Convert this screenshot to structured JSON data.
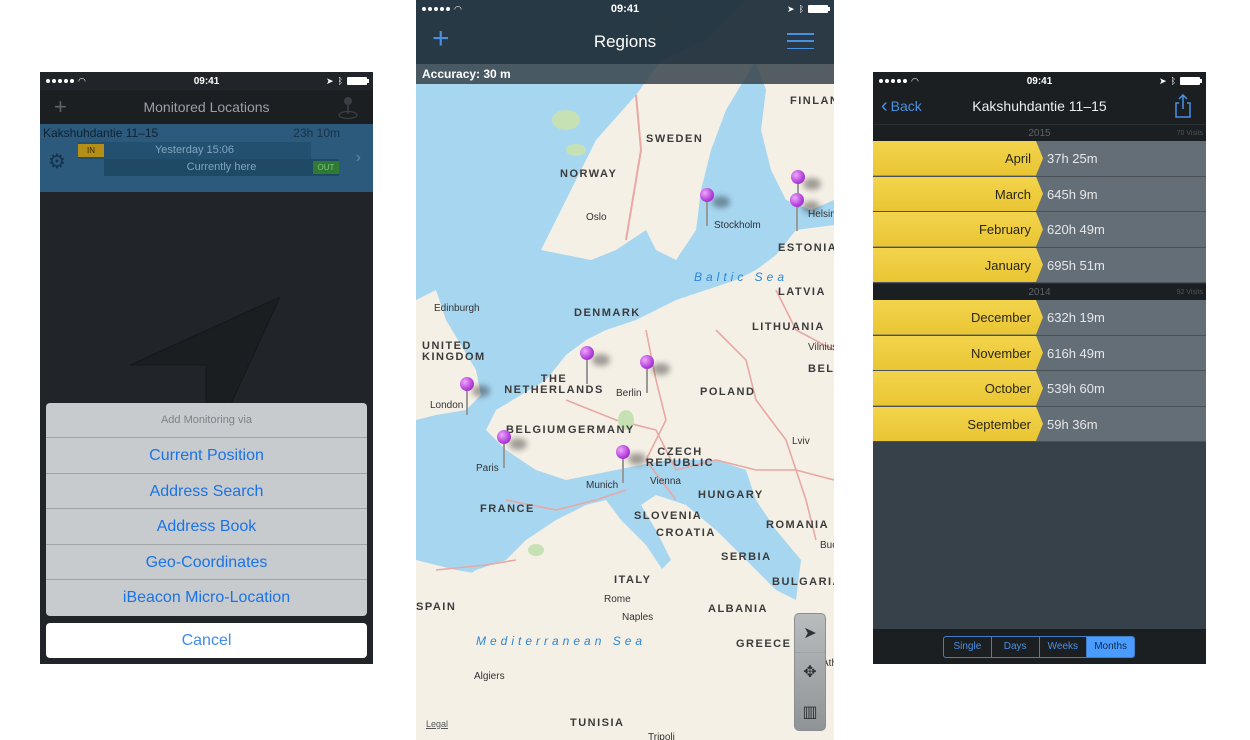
{
  "status_bar": {
    "time": "09:41",
    "signal_dots": 5
  },
  "screen_monitored": {
    "title": "Monitored Locations",
    "add_icon": "plus-icon",
    "map_pin_icon": "map-pin-icon",
    "location": {
      "name": "Kakshuhdantie 11–15",
      "duration": "23h 10m",
      "in_badge": "IN",
      "out_badge": "OUT",
      "entered": "Yesterday 15:06",
      "exited": "Currently here"
    },
    "action_sheet": {
      "title": "Add Monitoring via",
      "items": [
        "Current Position",
        "Address Search",
        "Address Book",
        "Geo-Coordinates",
        "iBeacon Micro-Location"
      ],
      "cancel": "Cancel"
    },
    "accent_color": "#1a73e8"
  },
  "screen_regions": {
    "title": "Regions",
    "accuracy": "Accuracy: 30 m",
    "legal": "Legal",
    "countries": [
      "FINLAND",
      "SWEDEN",
      "NORWAY",
      "ESTONIA",
      "LATVIA",
      "DENMARK",
      "LITHUANIA",
      "UNITED KINGDOM",
      "THE NETHERLANDS",
      "POLAND",
      "BELGIUM",
      "GERMANY",
      "CZECH REPUBLIC",
      "FRANCE",
      "HUNGARY",
      "SLOVENIA",
      "CROATIA",
      "ROMANIA",
      "SERBIA",
      "BULGARIA",
      "ITALY",
      "SPAIN",
      "ALBANIA",
      "GREECE",
      "TUNISIA",
      "BELARUS"
    ],
    "cities": [
      "Oslo",
      "Stockholm",
      "Helsinki",
      "Edinburgh",
      "Vilnius",
      "Berlin",
      "London",
      "Paris",
      "Munich",
      "Vienna",
      "Lviv",
      "Rome",
      "Naples",
      "Algiers",
      "Bucharest",
      "Athens",
      "Tripoli"
    ],
    "seas": [
      "Baltic Sea",
      "Mediterranean Sea"
    ],
    "pin_color": "#b03ed8",
    "controls": [
      "locate-icon",
      "move-icon",
      "map-icon"
    ]
  },
  "screen_detail": {
    "back": "Back",
    "title": "Kakshuhdantie 11–15",
    "share_icon": "share-icon",
    "groups": [
      {
        "year": "2015",
        "visits": "70 Visits",
        "months": [
          {
            "name": "April",
            "time": "37h 25m"
          },
          {
            "name": "March",
            "time": "645h 9m"
          },
          {
            "name": "February",
            "time": "620h 49m"
          },
          {
            "name": "January",
            "time": "695h 51m"
          }
        ]
      },
      {
        "year": "2014",
        "visits": "92 Visits",
        "months": [
          {
            "name": "December",
            "time": "632h 19m"
          },
          {
            "name": "November",
            "time": "616h 49m"
          },
          {
            "name": "October",
            "time": "539h 60m"
          },
          {
            "name": "September",
            "time": "59h 36m"
          }
        ]
      }
    ],
    "segments": [
      "Single",
      "Days",
      "Weeks",
      "Months"
    ],
    "active_segment": "Months",
    "highlight_color": "#f3d44c"
  }
}
